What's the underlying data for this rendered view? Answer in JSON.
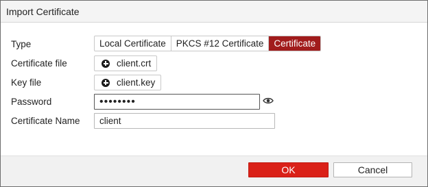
{
  "dialog": {
    "title": "Import Certificate"
  },
  "form": {
    "type": {
      "label": "Type",
      "options": [
        "Local Certificate",
        "PKCS #12 Certificate",
        "Certificate"
      ],
      "selected": "Certificate"
    },
    "certificate_file": {
      "label": "Certificate file",
      "value": "client.crt",
      "icon": "plus-circle-icon"
    },
    "key_file": {
      "label": "Key file",
      "value": "client.key",
      "icon": "plus-circle-icon"
    },
    "password": {
      "label": "Password",
      "value": "••••••••",
      "icon": "eye-icon"
    },
    "certificate_name": {
      "label": "Certificate Name",
      "value": "client"
    }
  },
  "footer": {
    "ok_label": "OK",
    "cancel_label": "Cancel"
  },
  "colors": {
    "selected_segment": "#a11c1c",
    "primary_button": "#da2118"
  }
}
